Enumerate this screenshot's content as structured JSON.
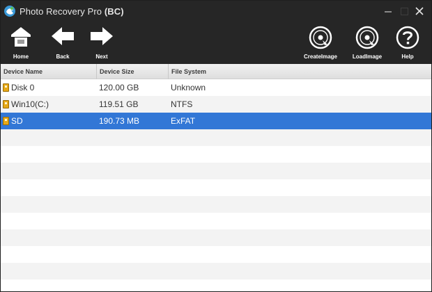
{
  "window": {
    "title_main": "Photo Recovery Pro",
    "title_suffix": "(BC)",
    "icon": "app-logo-icon"
  },
  "toolbar": {
    "home_label": "Home",
    "back_label": "Back",
    "next_label": "Next",
    "create_image_label": "CreateImage",
    "load_image_label": "LoadImage",
    "help_label": "Help"
  },
  "table": {
    "headers": {
      "name": "Device Name",
      "size": "Device Size",
      "fs": "File System"
    },
    "rows": [
      {
        "name": "Disk 0",
        "size": "120.00 GB",
        "fs": "Unknown",
        "icon": "drive-icon"
      },
      {
        "name": "Win10(C:)",
        "size": "119.51 GB",
        "fs": "NTFS",
        "icon": "drive-icon"
      },
      {
        "name": "SD",
        "size": "190.73 MB",
        "fs": "ExFAT",
        "icon": "drive-icon",
        "selected": true
      }
    ]
  },
  "colors": {
    "titlebar": "#262626",
    "selection": "#3277d6",
    "drive_icon": "#e6a817"
  }
}
